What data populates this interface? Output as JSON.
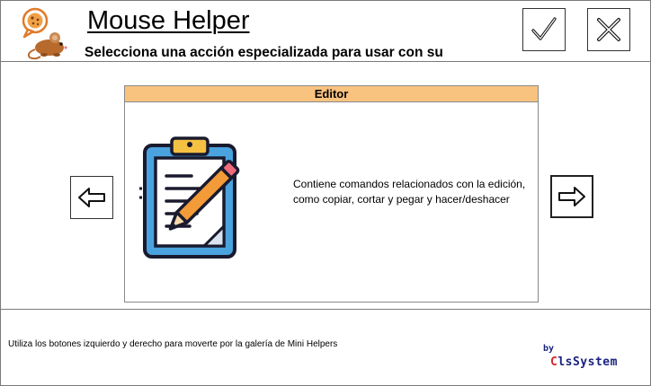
{
  "header": {
    "title": "Mouse Helper",
    "subtitle": "Selecciona una acción especializada para usar con su",
    "logo_icon": "mouse-cookie-icon",
    "ok_icon": "checkmark-icon",
    "close_icon": "close-x-icon"
  },
  "card": {
    "title": "Editor",
    "description": "Contiene comandos relacionados con la edición, como copiar, cortar y pegar y hacer/deshacer",
    "image_icon": "clipboard-pencil-icon",
    "header_color": "#f8c27f"
  },
  "nav": {
    "prev_icon": "arrow-left-icon",
    "next_icon": "arrow-right-icon"
  },
  "footer": {
    "hint": "Utiliza los botones izquierdo y derecho para moverte por la galería de Mini Helpers",
    "by_label": "by",
    "brand_first": "C",
    "brand_rest": "lsSystem"
  }
}
